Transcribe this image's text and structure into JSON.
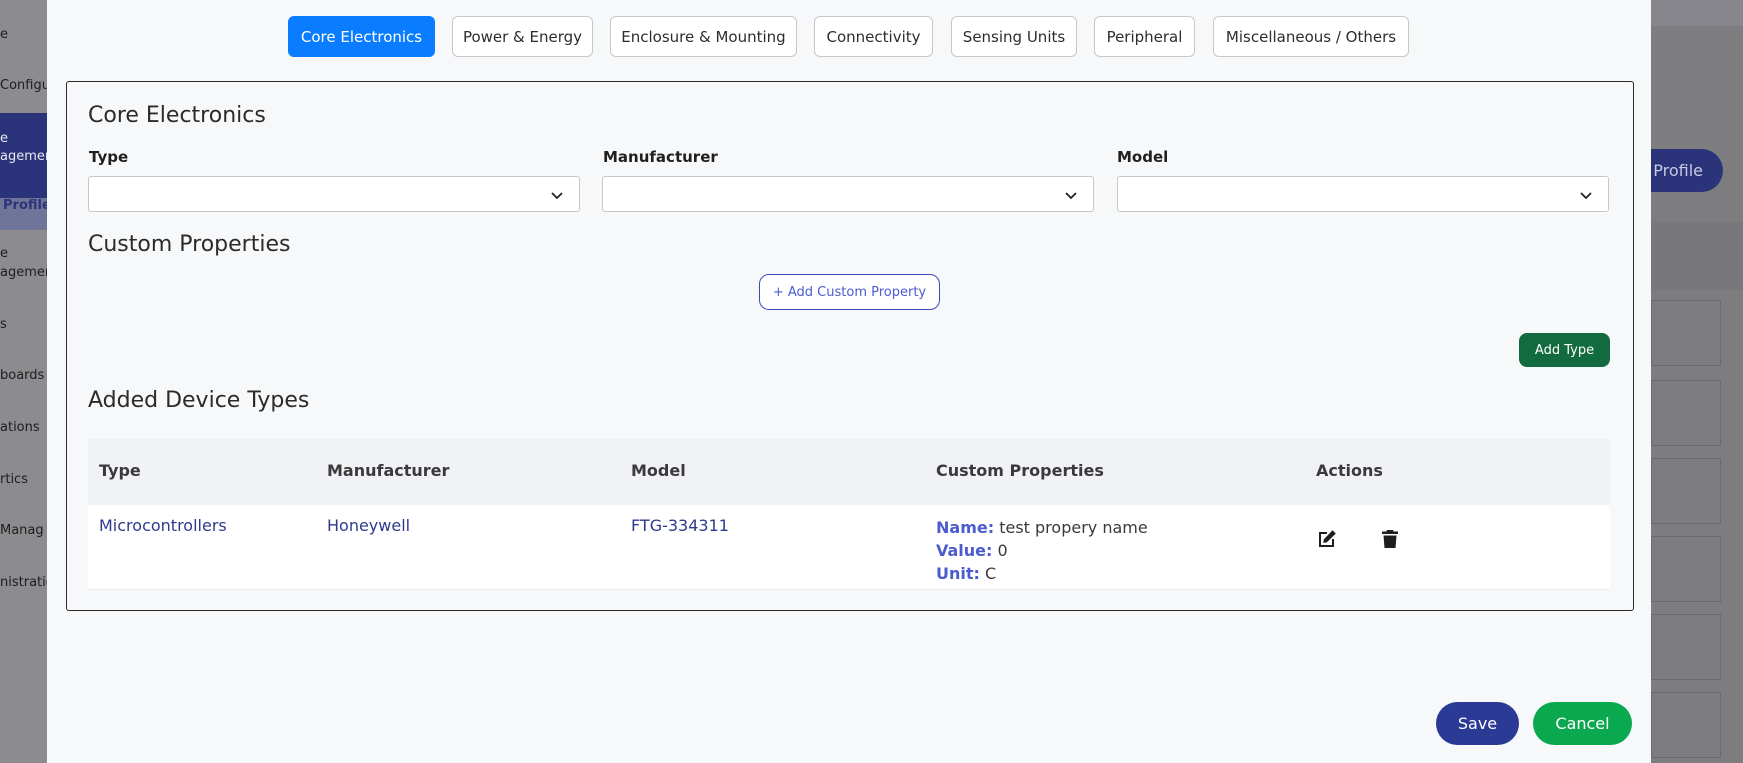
{
  "background": {
    "sidebar_items": [
      {
        "label": "e"
      },
      {
        "label": "Configu"
      },
      {
        "label": "e"
      },
      {
        "label": "agemen"
      },
      {
        "label": "Profiles"
      },
      {
        "label": "e"
      },
      {
        "label": "agemen"
      },
      {
        "label": "s"
      },
      {
        "label": "boards"
      },
      {
        "label": "ations"
      },
      {
        "label": "rtics"
      },
      {
        "label": "Manag"
      },
      {
        "label": "nistratio"
      }
    ],
    "profile_button": "Profile"
  },
  "tabs": [
    {
      "label": "Core Electronics",
      "active": true
    },
    {
      "label": "Power & Energy",
      "active": false
    },
    {
      "label": "Enclosure & Mounting",
      "active": false
    },
    {
      "label": "Connectivity",
      "active": false
    },
    {
      "label": "Sensing Units",
      "active": false
    },
    {
      "label": "Peripheral",
      "active": false
    },
    {
      "label": "Miscellaneous / Others",
      "active": false
    }
  ],
  "form": {
    "title": "Core Electronics",
    "type_label": "Type",
    "manufacturer_label": "Manufacturer",
    "model_label": "Model",
    "type_value": "",
    "manufacturer_value": "",
    "model_value": ""
  },
  "custom_properties": {
    "title": "Custom Properties",
    "add_button": "+ Add Custom Property",
    "add_type_button": "Add Type"
  },
  "added_types": {
    "title": "Added Device Types",
    "headers": [
      "Type",
      "Manufacturer",
      "Model",
      "Custom Properties",
      "Actions"
    ],
    "rows": [
      {
        "type": "Microcontrollers",
        "manufacturer": "Honeywell",
        "model": "FTG-334311",
        "props": {
          "name_key": "Name:",
          "name_value": "test propery name",
          "value_key": "Value:",
          "value_value": "0",
          "unit_key": "Unit:",
          "unit_value": "C"
        },
        "actions": [
          "edit-icon",
          "trash-icon"
        ]
      }
    ]
  },
  "footer": {
    "save": "Save",
    "cancel": "Cancel"
  },
  "colors": {
    "tab_active": "#0a7cff",
    "add_type": "#126b3f",
    "save": "#2b3a94",
    "cancel": "#0aa84f",
    "link": "#2e3a8c"
  }
}
